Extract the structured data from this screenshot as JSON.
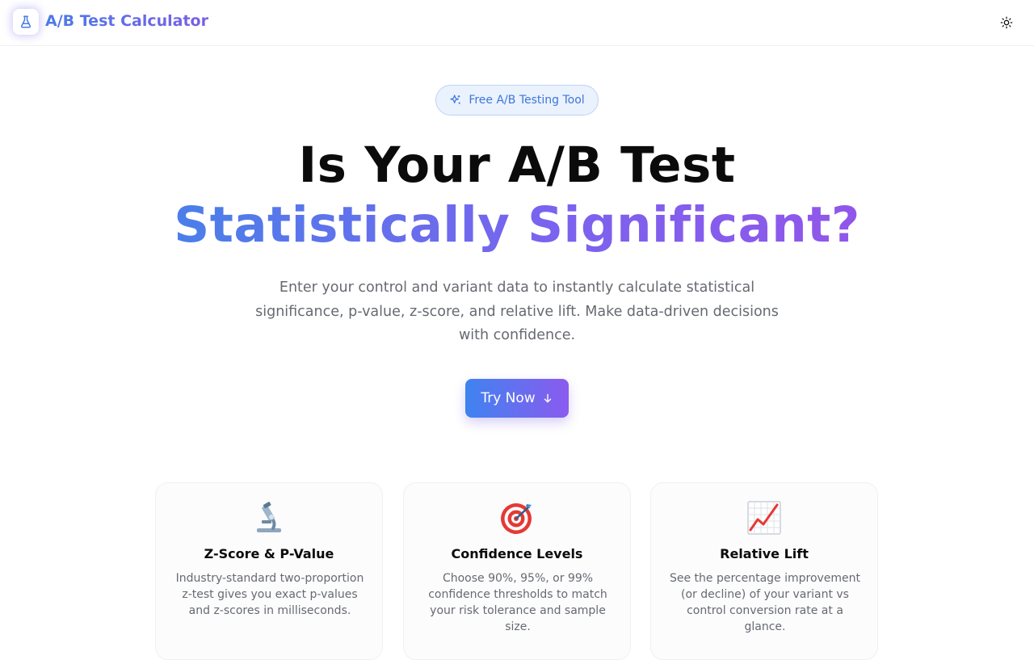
{
  "header": {
    "brand": "A/B Test Calculator",
    "logo_icon": "flask-icon",
    "theme_icon": "sun-icon"
  },
  "hero": {
    "badge_icon": "sparkles-icon",
    "badge_label": "Free A/B Testing Tool",
    "title_line1": "Is Your A/B Test",
    "title_line2": "Statistically Significant?",
    "subtitle": "Enter your control and variant data to instantly calculate statistical significance, p-value, z-score, and relative lift. Make data-driven decisions with confidence.",
    "cta_label": "Try Now",
    "cta_icon": "arrow-down-icon"
  },
  "features": [
    {
      "icon": "microscope-icon",
      "title": "Z-Score & P-Value",
      "text": "Industry-standard two-proportion z-test gives you exact p-values and z-scores in milliseconds."
    },
    {
      "icon": "target-icon",
      "title": "Confidence Levels",
      "text": "Choose 90%, 95%, or 99% confidence thresholds to match your risk tolerance and sample size."
    },
    {
      "icon": "chart-increasing-icon",
      "title": "Relative Lift",
      "text": "See the percentage improvement (or decline) of your variant vs control conversion rate at a glance."
    }
  ],
  "colors": {
    "brand_start": "#4b7be8",
    "brand_end": "#8b5bef",
    "badge_bg": "#eaf2fd",
    "badge_text": "#3e76d8",
    "muted_text": "#666a70"
  }
}
